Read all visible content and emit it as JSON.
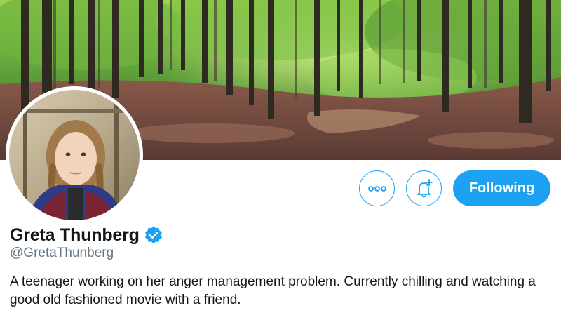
{
  "profile": {
    "display_name": "Greta Thunberg",
    "handle": "@GretaThunberg",
    "bio": "A teenager working on her anger management problem. Currently chilling and watching a good old fashioned movie with a friend.",
    "verified": true
  },
  "actions": {
    "more_icon": "more-dots-icon",
    "notify_icon": "bell-plus-icon",
    "following_label": "Following"
  },
  "colors": {
    "accent": "#1da1f2",
    "text_primary": "#14171a",
    "text_secondary": "#657786"
  }
}
